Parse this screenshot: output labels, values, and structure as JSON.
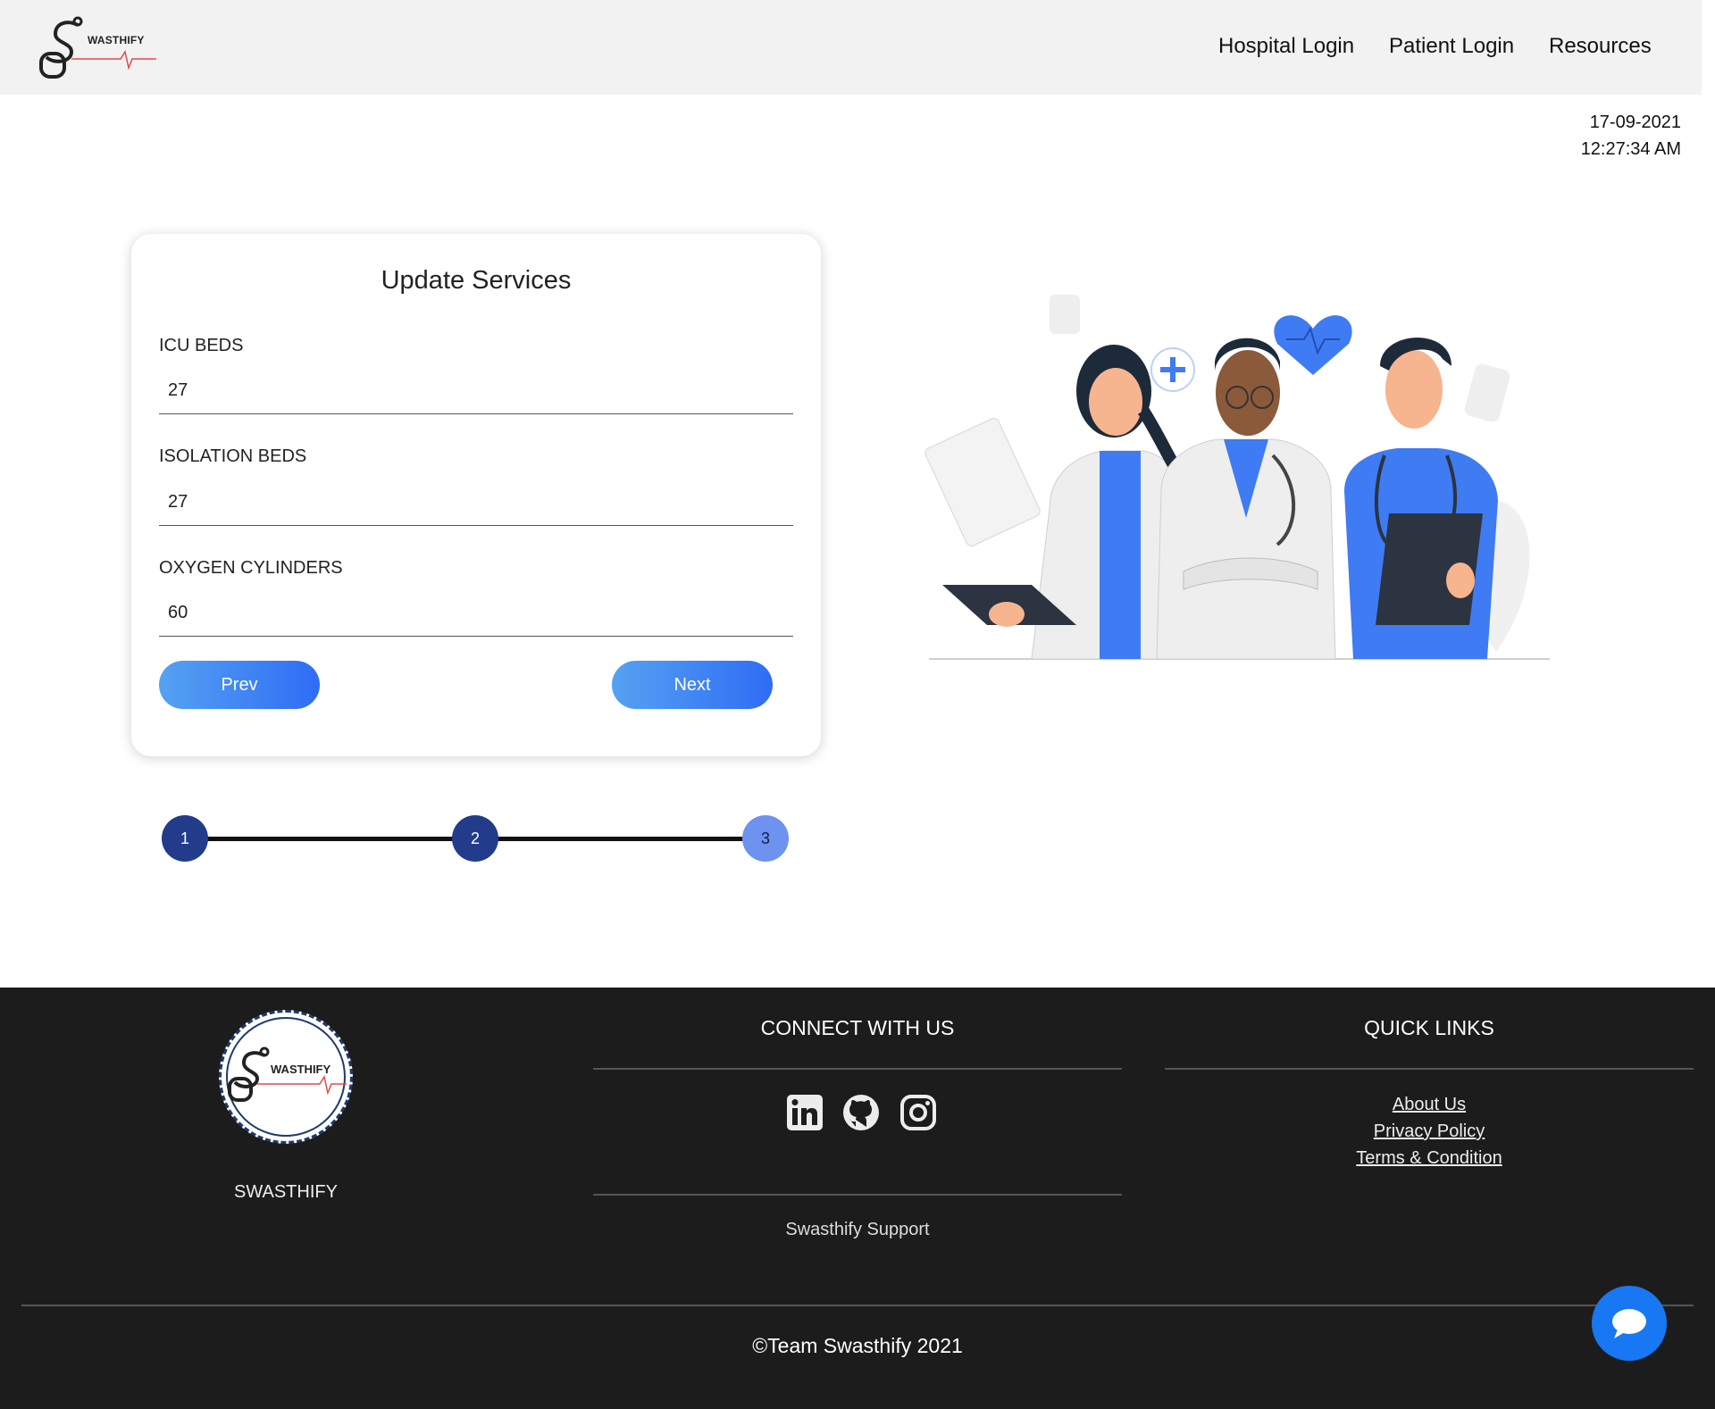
{
  "header": {
    "brand": "WASTHIFY",
    "nav": [
      "Hospital Login",
      "Patient Login",
      "Resources"
    ]
  },
  "datetime": {
    "date": "17-09-2021",
    "time": "12:27:34 AM"
  },
  "form": {
    "title": "Update Services",
    "fields": [
      {
        "label": "ICU BEDS",
        "value": "27"
      },
      {
        "label": "ISOLATION BEDS",
        "value": "27"
      },
      {
        "label": "OXYGEN CYLINDERS",
        "value": "60"
      }
    ],
    "prev_label": "Prev",
    "next_label": "Next"
  },
  "stepper": {
    "steps": [
      "1",
      "2",
      "3"
    ],
    "current": 3,
    "colors": {
      "done": "#233b8b",
      "current": "#6e92f0"
    }
  },
  "footer": {
    "logo_text": "WASTHIFY",
    "brand": "SWASTHIFY",
    "connect_title": "CONNECT WITH US",
    "social_icons": [
      "linkedin-icon",
      "github-icon",
      "instagram-icon"
    ],
    "support": "Swasthify Support",
    "quick_title": "QUICK LINKS",
    "quick_links": [
      "About Us",
      "Privacy Policy",
      "Terms & Condition"
    ],
    "copyright": "©Team Swasthify 2021"
  },
  "colors": {
    "accent": "#2f6cf5",
    "footer_bg": "#1c1c1c",
    "chat": "#1877f2"
  }
}
